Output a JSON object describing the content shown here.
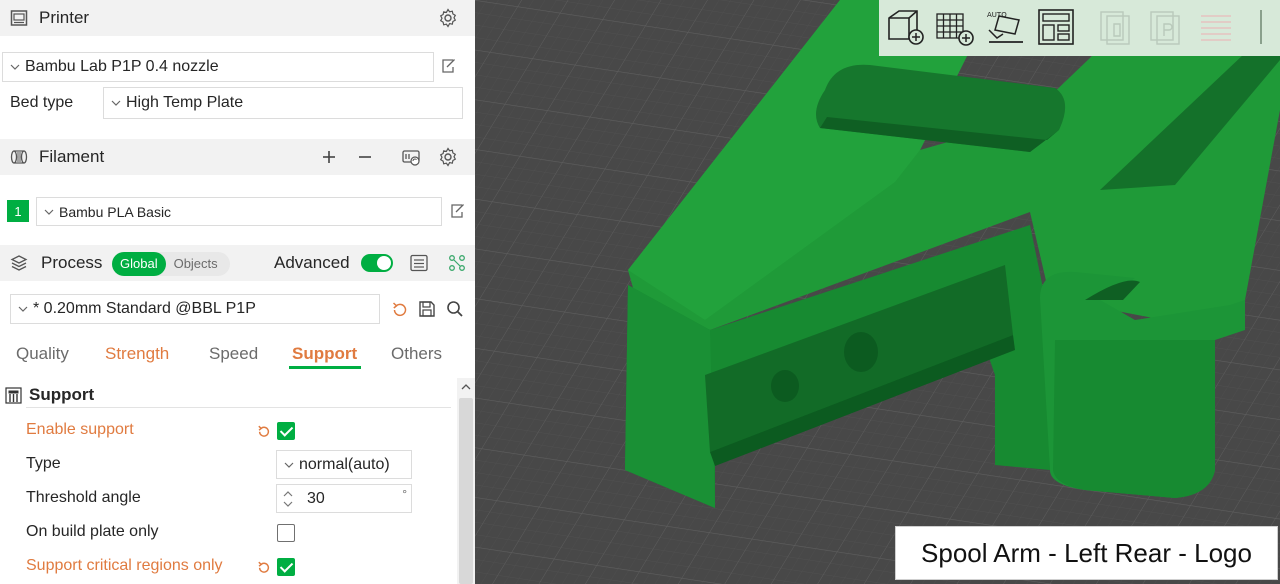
{
  "printer": {
    "section_title": "Printer",
    "preset": "Bambu Lab P1P 0.4 nozzle",
    "bed_type_label": "Bed type",
    "bed_type_value": "High Temp Plate"
  },
  "filament": {
    "section_title": "Filament",
    "slot_number": "1",
    "slot_color": "#00ae42",
    "preset": "Bambu PLA Basic"
  },
  "process": {
    "section_title": "Process",
    "scope_global": "Global",
    "scope_objects": "Objects",
    "advanced_label": "Advanced",
    "advanced_enabled": true,
    "preset": "* 0.20mm Standard @BBL P1P"
  },
  "tabs": [
    "Quality",
    "Strength",
    "Speed",
    "Support",
    "Others"
  ],
  "active_tab": "Support",
  "support": {
    "group_title": "Support",
    "enable_label": "Enable support",
    "enable_checked": true,
    "type_label": "Type",
    "type_value": "normal(auto)",
    "threshold_label": "Threshold angle",
    "threshold_value": "30",
    "threshold_unit": "°",
    "build_plate_label": "On build plate only",
    "build_plate_checked": false,
    "critical_label": "Support critical regions only",
    "critical_checked": true
  },
  "viewport": {
    "caption": "Spool Arm - Left Rear - Logo",
    "model_color": "#1f8f35",
    "toolbar_icons": [
      "add-cube-icon",
      "add-plate-icon",
      "auto-orient-icon",
      "arrange-icon",
      "copy-plate-icon",
      "paste-plate-icon",
      "slice-lines-icon"
    ]
  },
  "colors": {
    "accent": "#00ae42",
    "modified_text": "#e07b40"
  }
}
